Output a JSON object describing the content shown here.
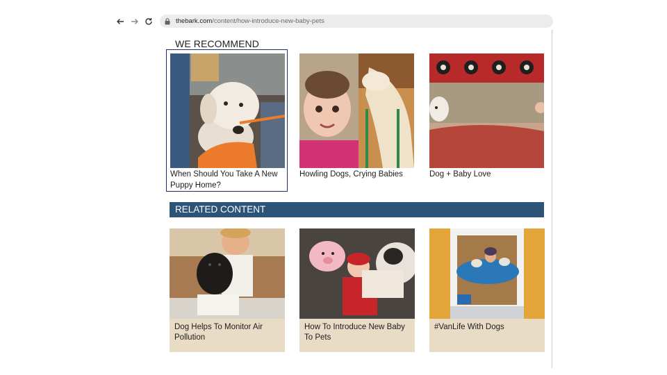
{
  "browser": {
    "url_domain": "thebark.com",
    "url_path": "/content/how-introduce-new-baby-pets"
  },
  "recommend": {
    "title": "WE RECOMMEND",
    "items": [
      {
        "caption": "When Should You Take A New Puppy Home?",
        "image": "puppy-with-toy"
      },
      {
        "caption": "Howling Dogs, Crying Babies",
        "image": "baby-and-dog"
      },
      {
        "caption": "Dog + Baby Love",
        "image": "dog-on-couch"
      }
    ]
  },
  "related": {
    "title": "RELATED CONTENT",
    "items": [
      {
        "caption": "Dog Helps To Monitor Air Pollution",
        "image": "boy-with-black-dog"
      },
      {
        "caption": "How To Introduce New Baby To Pets",
        "image": "baby-with-dog-and-toy"
      },
      {
        "caption": "#VanLife With Dogs",
        "image": "woman-in-van-with-dogs"
      }
    ]
  },
  "colors": {
    "related_bar": "#2c5478",
    "card_bg": "#e8dcc7",
    "focus_ring": "#1f2a7a"
  }
}
